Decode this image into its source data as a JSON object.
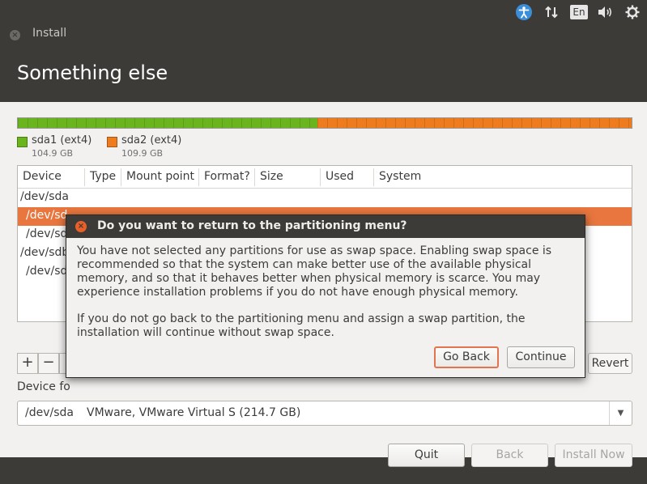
{
  "topbar": {
    "icons": [
      "accessibility-icon",
      "network-icon",
      "keyboard-indicator",
      "volume-icon",
      "gear-icon"
    ],
    "keyboard_layout": "En"
  },
  "window": {
    "title": "Install",
    "heading": "Something else"
  },
  "partition_bar": {
    "segments": [
      {
        "name": "sda1 (ext4)",
        "size": "104.9 GB",
        "color": "#6ab51e",
        "fraction": 0.488
      },
      {
        "name": "sda2 (ext4)",
        "size": "109.9 GB",
        "color": "#ef7b1f",
        "fraction": 0.512
      }
    ]
  },
  "table": {
    "columns": [
      "Device",
      "Type",
      "Mount point",
      "Format?",
      "Size",
      "Used",
      "System"
    ],
    "rows": [
      {
        "device": "/dev/sda",
        "selected": false
      },
      {
        "device": "/dev/sd",
        "selected": true
      },
      {
        "device": "/dev/sd",
        "selected": false
      },
      {
        "device": "/dev/sdb",
        "selected": false
      },
      {
        "device": "/dev/sd",
        "selected": false
      }
    ]
  },
  "toolbar": {
    "add_label": "+",
    "remove_label": "−",
    "revert_label": "Revert"
  },
  "bootloader": {
    "label": "Device fo",
    "device": "/dev/sda",
    "description": "VMware, VMware Virtual S (214.7 GB)"
  },
  "buttons": {
    "quit": "Quit",
    "back": "Back",
    "install_now": "Install Now"
  },
  "dialog": {
    "title": "Do you want to return to the partitioning menu?",
    "paragraph1": "You have not selected any partitions for use as swap space. Enabling swap space is recommended so that the system can make better use of the available physical memory, and so that it behaves better when physical memory is scarce. You may experience installation problems if you do not have enough physical memory.",
    "paragraph2": "If you do not go back to the partitioning menu and assign a swap partition, the installation will continue without swap space.",
    "go_back": "Go Back",
    "continue": "Continue"
  }
}
